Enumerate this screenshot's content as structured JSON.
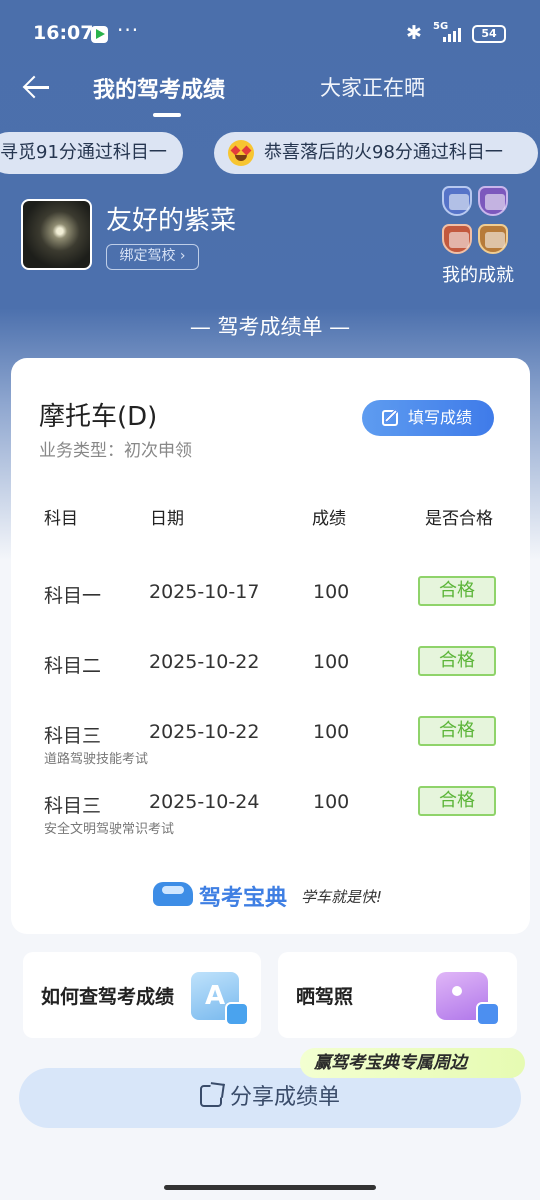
{
  "status_bar": {
    "time": "16:07",
    "dots": "···",
    "network": "5G",
    "battery": "54"
  },
  "header": {
    "title": "我的驾考成绩",
    "tab2": "大家正在晒"
  },
  "marquee": [
    "寻觅91分通过科目一",
    "恭喜落后的火98分通过科目一"
  ],
  "profile": {
    "name": "友好的紫菜",
    "bind_school": "绑定驾校 ›",
    "achievements": "我的成就"
  },
  "section_title": "— 驾考成绩单 —",
  "card": {
    "vehicle": "摩托车(D)",
    "business_type": "业务类型：初次申领",
    "fill_button": "填写成绩",
    "headers": [
      "科目",
      "日期",
      "成绩",
      "是否合格"
    ],
    "rows": [
      {
        "subject": "科目一",
        "date": "2025-10-17",
        "score": "100",
        "result": "合格",
        "note": ""
      },
      {
        "subject": "科目二",
        "date": "2025-10-22",
        "score": "100",
        "result": "合格",
        "note": ""
      },
      {
        "subject": "科目三",
        "date": "2025-10-22",
        "score": "100",
        "result": "合格",
        "note": "道路驾驶技能考试"
      },
      {
        "subject": "科目三",
        "date": "2025-10-24",
        "score": "100",
        "result": "合格",
        "note": "安全文明驾驶常识考试"
      }
    ],
    "brand": "驾考宝典",
    "slogan": "学车就是快!"
  },
  "links": {
    "query": "如何查驾考成绩",
    "query_icon_letter": "A",
    "license": "晒驾照"
  },
  "promo": "赢驾考宝典专属周边",
  "share_button": "分享成绩单",
  "colors": {
    "primary": "#4b6fab",
    "accent": "#3f7be9",
    "pass": "#5cb539"
  }
}
